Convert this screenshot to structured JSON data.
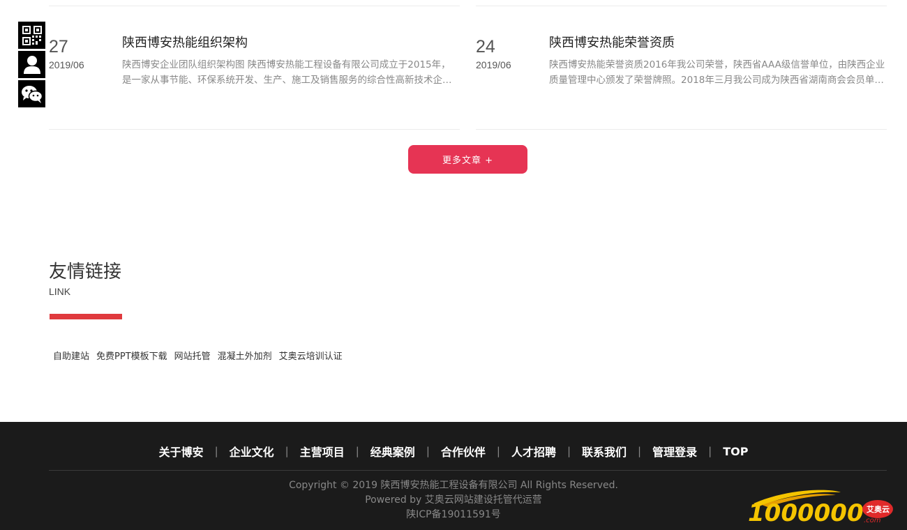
{
  "news": [
    {
      "day": "27",
      "year_month": "2019/06",
      "title": "陕西博安热能组织架构",
      "desc": "陕西博安企业团队组织架构图 陕西博安热能工程设备有限公司成立于2015年，是一家从事节能、环保系统开发、生产、施工及销售服务的综合性高新技术企业。"
    },
    {
      "day": "24",
      "year_month": "2019/06",
      "title": "陕西博安热能荣誉资质",
      "desc": "陕西博安热能荣誉资质2016年我公司荣誉，陕西省AAA级信誉单位，由陕西企业质量管理中心颁发了荣誉牌照。2018年三月我公司成为陕西省湖南商会会员单位。"
    }
  ],
  "more_button": "更多文章 +",
  "friend_links": {
    "title": "友情链接",
    "subtitle": "LINK",
    "items": [
      "自助建站",
      "免费PPT模板下载",
      "网站托管",
      "混凝土外加剂",
      "艾奥云培训认证"
    ]
  },
  "footer": {
    "nav": [
      "关于博安",
      "企业文化",
      "主营项目",
      "经典案例",
      "合作伙伴",
      "人才招聘",
      "联系我们",
      "管理登录",
      "TOP"
    ],
    "separator": "|",
    "copyright": "Copyright © 2019 陕西博安热能工程设备有限公司 All Rights Reserved.",
    "powered": "Powered by 艾奥云网站建设托管代运营",
    "icp": "陕ICP备19011591号"
  },
  "logo": {
    "text": "1000000",
    "badge": "艾奥云",
    "suffix": ".com"
  },
  "side_icons": [
    "qrcode-icon",
    "user-icon",
    "wechat-icon"
  ],
  "colors": {
    "accent": "#e63454",
    "bar": "#e03a3e",
    "footer_bg": "#1b1b1b",
    "logo_yellow": "#f5c400",
    "logo_red": "#e02a2a"
  }
}
